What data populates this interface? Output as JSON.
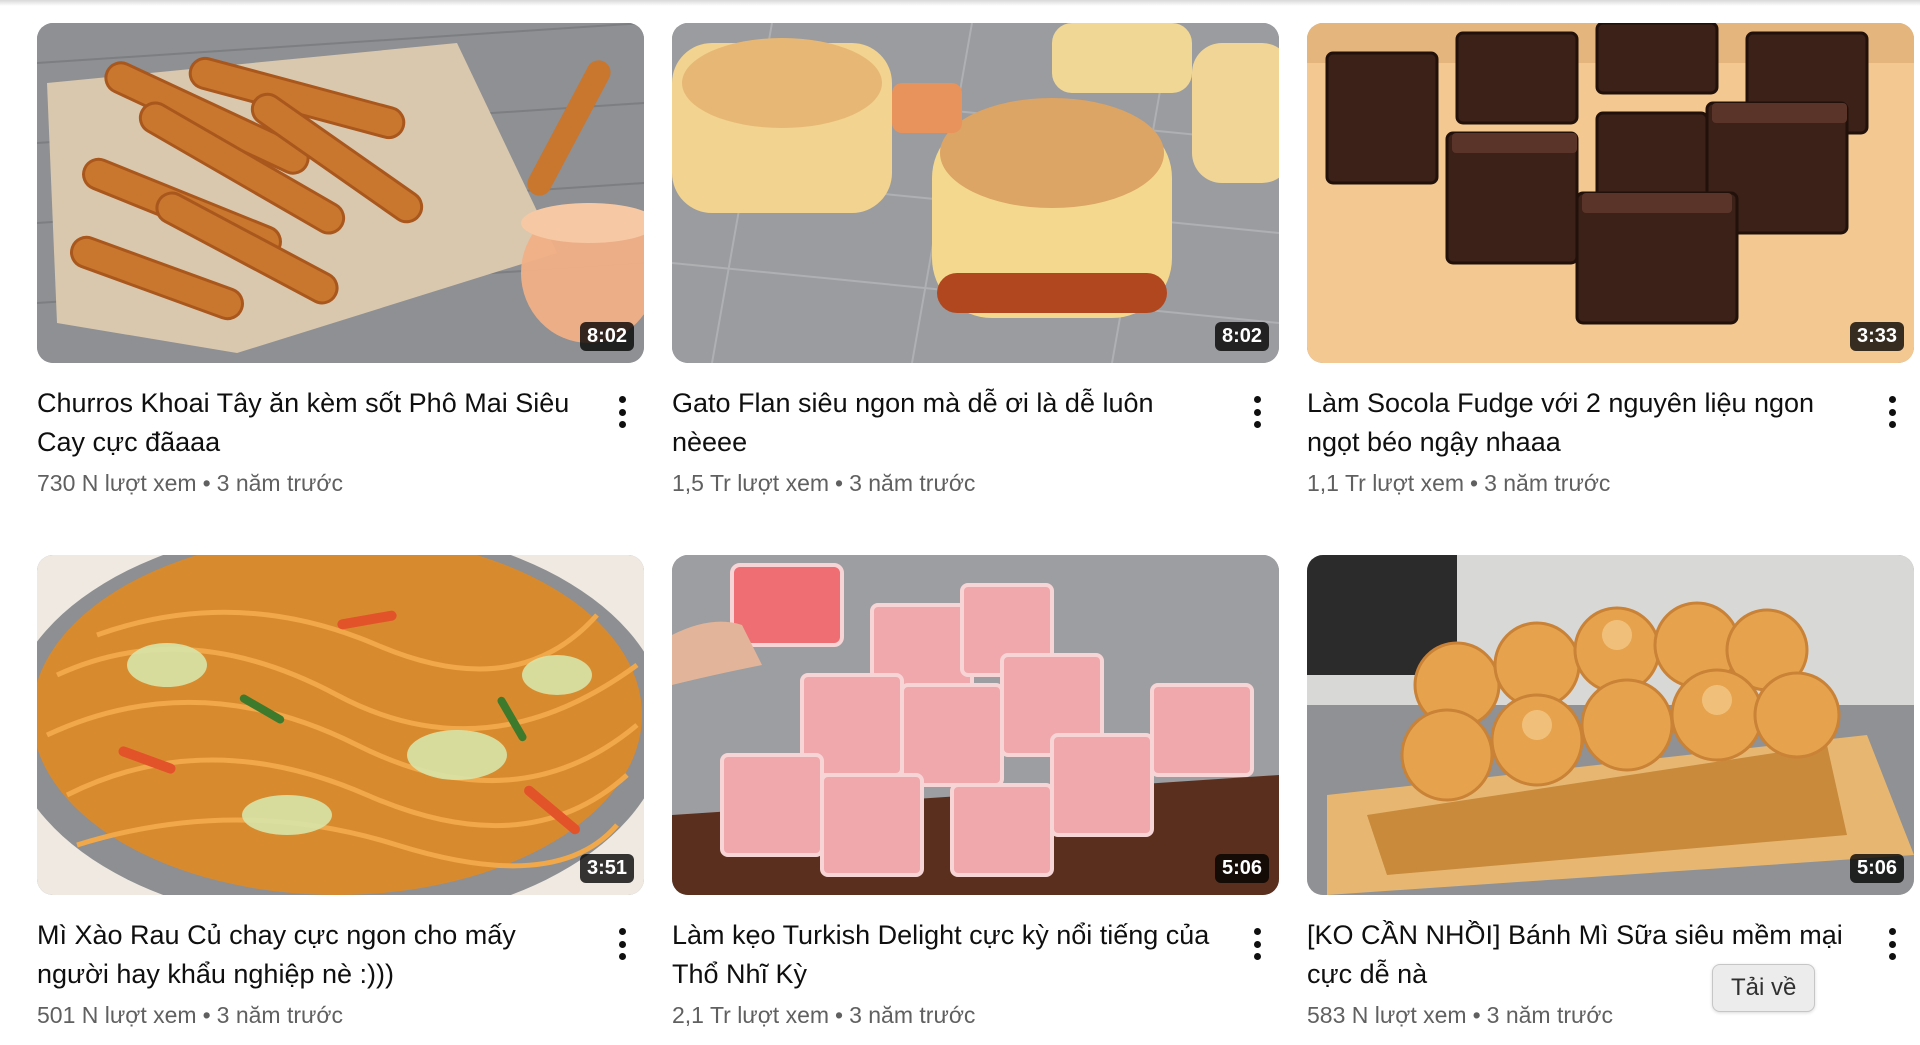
{
  "videos": [
    {
      "title": "Churros Khoai Tây ăn kèm sốt Phô Mai Siêu Cay cực đãaaa",
      "views": "730 N lượt xem",
      "age": "3 năm trước",
      "duration": "8:02",
      "thumb": "churros"
    },
    {
      "title": "Gato Flan siêu ngon mà dễ ơi là dễ luôn nèeee",
      "views": "1,5 Tr lượt xem",
      "age": "3 năm trước",
      "duration": "8:02",
      "thumb": "flan"
    },
    {
      "title": "Làm Socola Fudge với 2 nguyên liệu ngon ngọt béo ngậy nhaaa",
      "views": "1,1 Tr lượt xem",
      "age": "3 năm trước",
      "duration": "3:33",
      "thumb": "fudge"
    },
    {
      "title": "Mì Xào Rau Củ chay cực ngon cho mấy người hay khẩu nghiệp nè :)))",
      "views": "501 N lượt xem",
      "age": "3 năm trước",
      "duration": "3:51",
      "thumb": "noodles"
    },
    {
      "title": "Làm kẹo Turkish Delight cực kỳ nổi tiếng của Thổ Nhĩ Kỳ",
      "views": "2,1 Tr lượt xem",
      "age": "3 năm trước",
      "duration": "5:06",
      "thumb": "turkish"
    },
    {
      "title": "[KO CẦN NHỒI] Bánh Mì Sữa siêu mềm mại cực dễ nà",
      "views": "583 N lượt xem",
      "age": "3 năm trước",
      "duration": "5:06",
      "thumb": "bread"
    }
  ],
  "separator": "•",
  "tooltip": "Tải về"
}
